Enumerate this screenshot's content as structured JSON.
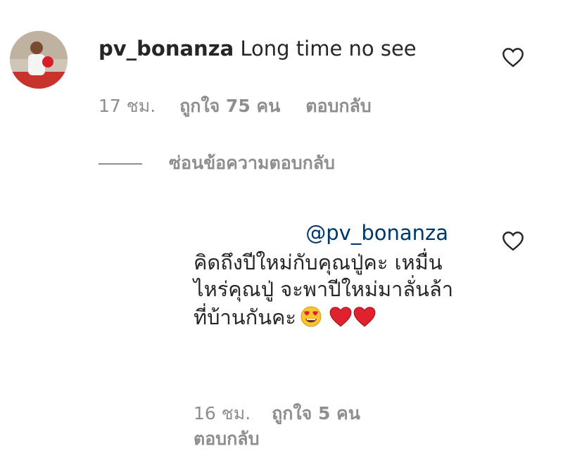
{
  "comment": {
    "username": "pv_bonanza",
    "text": "Long time no see",
    "time": "17 ชม.",
    "likes": "ถูกใจ 75 คน",
    "reply_label": "ตอบกลับ"
  },
  "thread": {
    "hide_replies_label": "ซ่อนข้อความตอบกลับ"
  },
  "reply": {
    "mention": "@pv_bonanza",
    "text": "คิดถึงปีใหม่กับคุณปู่คะ เหมื่นไหร่คุณปู่ จะพาปีใหม่มาลั่นล้าที่บ้านกันคะ",
    "emojis": [
      "heart-eyes-emoji",
      "red-heart-emoji",
      "red-heart-emoji"
    ],
    "time": "16 ชม.",
    "likes": "ถูกใจ 5 คน",
    "reply_label": "ตอบกลับ"
  },
  "colors": {
    "text": "#262626",
    "secondary": "#8e8e8e",
    "mention": "#00376b",
    "heart_red": "#e0222e"
  }
}
